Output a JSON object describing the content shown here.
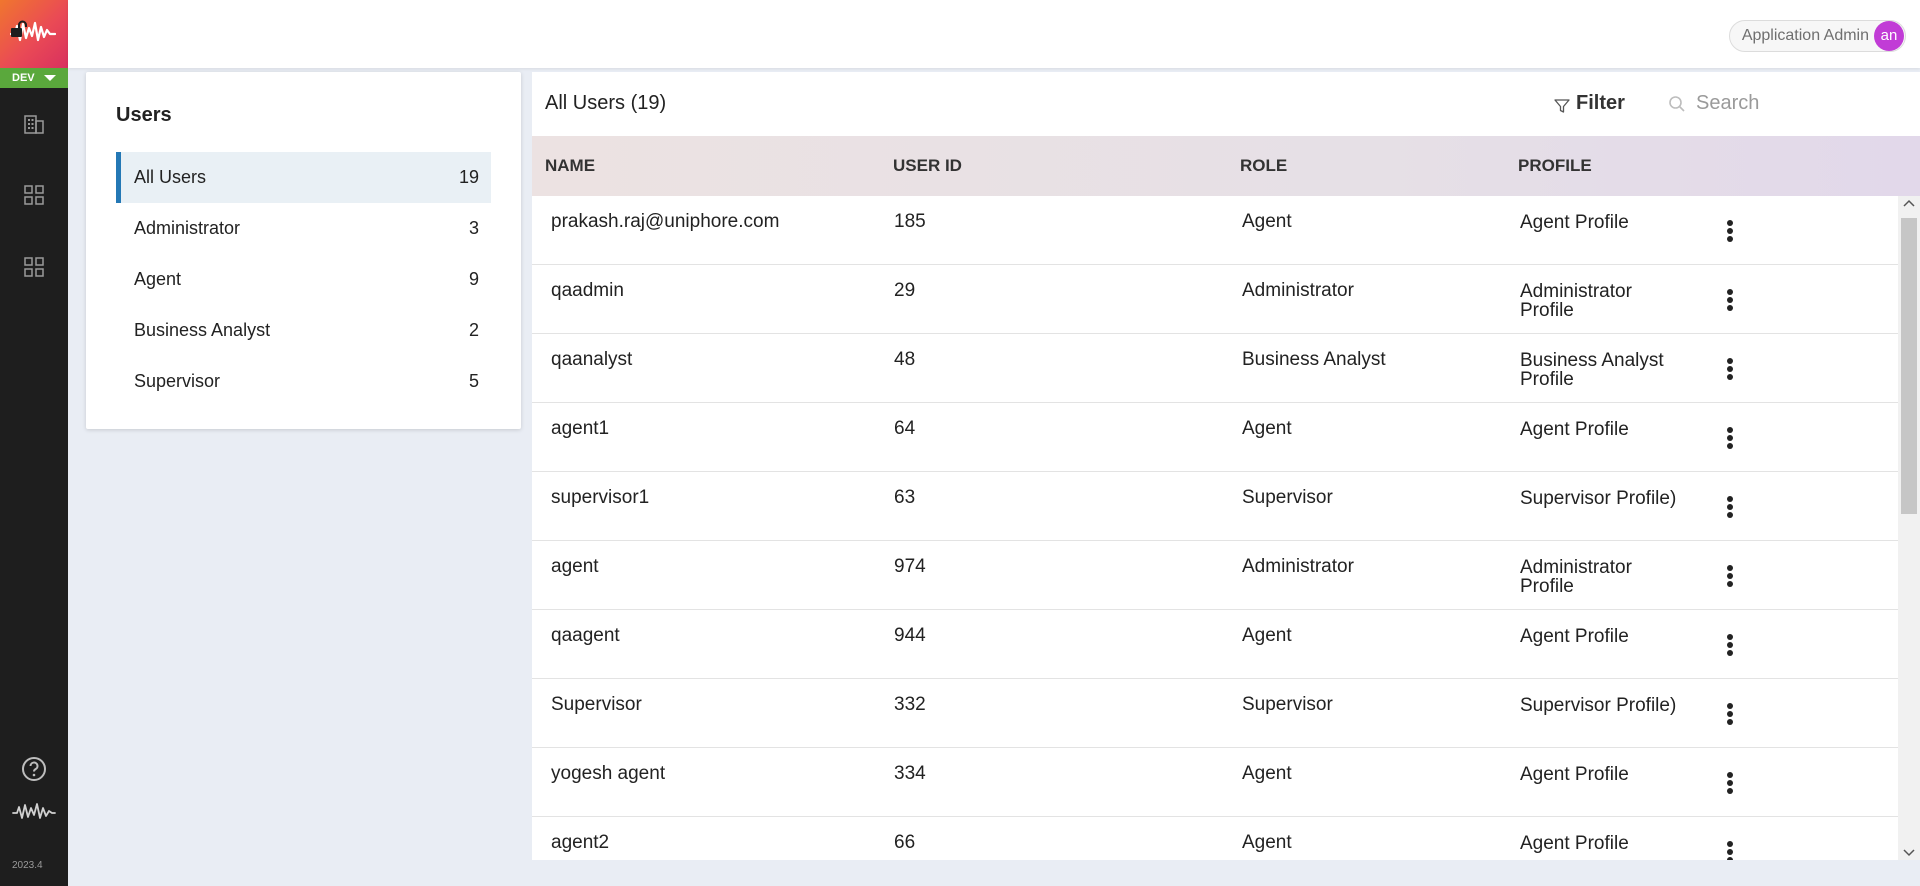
{
  "rail": {
    "env": "DEV",
    "version": "2023.4",
    "icons": [
      "building-icon",
      "grid-icon",
      "grid-icon",
      "help-icon",
      "wave-logo-icon"
    ]
  },
  "header": {
    "user_name": "Application Admin",
    "avatar_initials": "an",
    "avatar_color": "#c13cd6"
  },
  "panel": {
    "title": "Users",
    "groups": [
      {
        "label": "All Users",
        "count": "19"
      },
      {
        "label": "Administrator",
        "count": "3"
      },
      {
        "label": "Agent",
        "count": "9"
      },
      {
        "label": "Business Analyst",
        "count": "2"
      },
      {
        "label": "Supervisor",
        "count": "5"
      }
    ]
  },
  "main": {
    "title": "All Users (19)",
    "filter_label": "Filter",
    "search_placeholder": "Search",
    "columns": [
      "NAME",
      "USER ID",
      "ROLE",
      "PROFILE"
    ],
    "rows": [
      {
        "name": "prakash.raj@uniphore.com",
        "id": "185",
        "role": "Agent",
        "profile": "Agent Profile"
      },
      {
        "name": "qaadmin",
        "id": "29",
        "role": "Administrator",
        "profile": "Administrator Profile"
      },
      {
        "name": "qaanalyst",
        "id": "48",
        "role": "Business Analyst",
        "profile": "Business Analyst Profile"
      },
      {
        "name": "agent1",
        "id": "64",
        "role": "Agent",
        "profile": "Agent Profile"
      },
      {
        "name": "supervisor1",
        "id": "63",
        "role": "Supervisor",
        "profile": "Supervisor Profile)"
      },
      {
        "name": "agent",
        "id": "974",
        "role": "Administrator",
        "profile": "Administrator Profile"
      },
      {
        "name": "qaagent",
        "id": "944",
        "role": "Agent",
        "profile": "Agent Profile"
      },
      {
        "name": "Supervisor",
        "id": "332",
        "role": "Supervisor",
        "profile": "Supervisor Profile)"
      },
      {
        "name": "yogesh agent",
        "id": "334",
        "role": "Agent",
        "profile": "Agent Profile"
      },
      {
        "name": "agent2",
        "id": "66",
        "role": "Agent",
        "profile": "Agent Profile"
      }
    ]
  },
  "colors": {
    "accent": "#2478b5",
    "env_badge": "#5aa83c",
    "rail_bg": "#1e1e1e"
  }
}
